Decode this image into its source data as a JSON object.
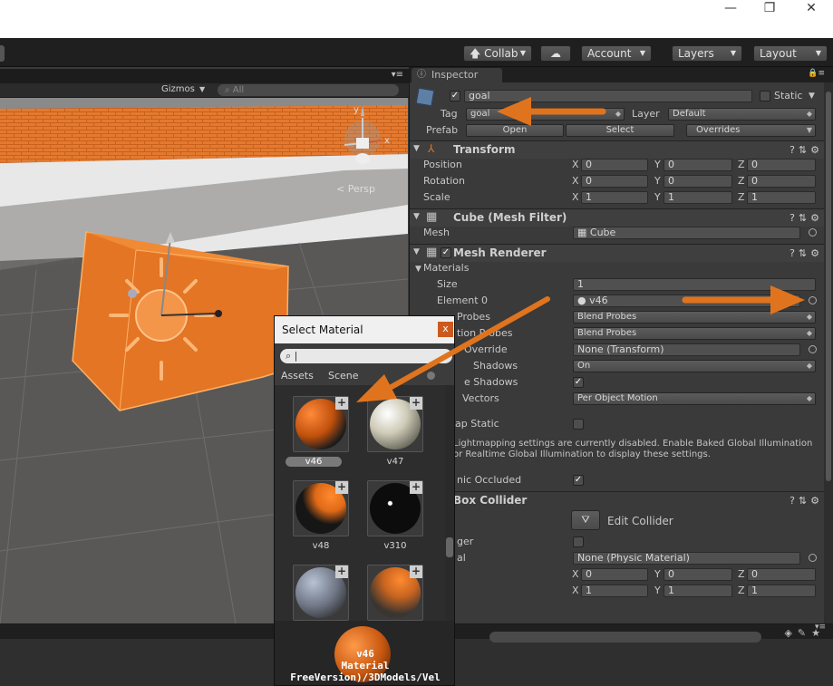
{
  "toolbar": {
    "collab": "Collab",
    "account": "Account",
    "layers": "Layers",
    "layout": "Layout"
  },
  "scene": {
    "gizmos": "Gizmos",
    "search_placeholder": "All",
    "persp": "< Persp",
    "axis_y": "y",
    "axis_x": "x"
  },
  "inspector": {
    "tab": "Inspector",
    "object_name": "goal",
    "static_label": "Static",
    "tag_label": "Tag",
    "tag_value": "goal",
    "layer_label": "Layer",
    "layer_value": "Default",
    "prefab_label": "Prefab",
    "prefab_open": "Open",
    "prefab_select": "Select",
    "prefab_overrides": "Overrides",
    "transform": {
      "title": "Transform",
      "position_label": "Position",
      "rotation_label": "Rotation",
      "scale_label": "Scale",
      "position": [
        "0",
        "0",
        "0"
      ],
      "rotation": [
        "0",
        "0",
        "0"
      ],
      "scale": [
        "1",
        "1",
        "1"
      ]
    },
    "mesh_filter": {
      "title": "Cube (Mesh Filter)",
      "mesh_label": "Mesh",
      "mesh_value": "Cube"
    },
    "mesh_renderer": {
      "title": "Mesh Renderer",
      "materials_label": "Materials",
      "size_label": "Size",
      "size_value": "1",
      "element0_label": "Element 0",
      "element0_value": "v46",
      "light_probes_label": "Probes",
      "light_probes_value": "Blend Probes",
      "reflection_label": "tion Probes",
      "reflection_value": "Blend Probes",
      "anchor_label": "Override",
      "anchor_value": "None (Transform)",
      "cast_label": "Shadows",
      "cast_value": "On",
      "receive_label": "e Shadows",
      "motion_label": "Vectors",
      "motion_value": "Per Object Motion",
      "lightmap_label": "ap Static",
      "info_line1": "Lightmapping settings are currently disabled. Enable Baked Global Illumination",
      "info_line2": "or Realtime Global Illumination to display these settings.",
      "dyn_label": "nic Occluded"
    },
    "box_collider": {
      "title": "Box Collider",
      "edit": "Edit Collider",
      "trigger_label": "ger",
      "material_label": "al",
      "material_value": "None (Physic Material)",
      "center": [
        "0",
        "0",
        "0"
      ],
      "size": [
        "1",
        "1",
        "1"
      ]
    },
    "x": "X",
    "y": "Y",
    "z": "Z"
  },
  "popup": {
    "title": "Select Material",
    "close": "x",
    "search_value": "|",
    "tab_assets": "Assets",
    "tab_scene": "Scene",
    "materials": [
      {
        "name": "v46",
        "selected": true
      },
      {
        "name": "v47",
        "selected": false
      },
      {
        "name": "v48",
        "selected": false
      },
      {
        "name": "v310",
        "selected": false
      },
      {
        "name": "",
        "selected": false
      },
      {
        "name": "",
        "selected": false
      }
    ],
    "preview_name": "v46",
    "preview_type": "Material",
    "preview_path": "FreeVersion)/3DModels/Vel"
  },
  "colors": {
    "accent_orange": "#e0741e",
    "panel": "#3a3a3a",
    "toolbar": "#1f1f1f"
  }
}
